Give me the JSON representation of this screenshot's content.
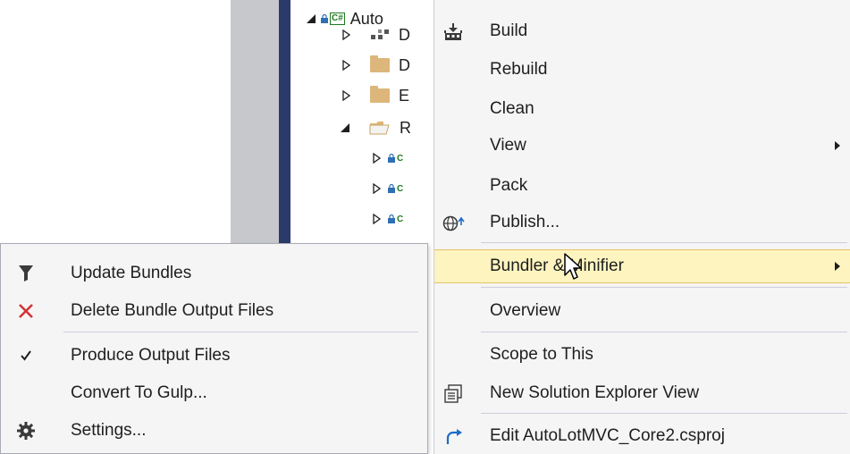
{
  "tree": {
    "project_label": "Auto",
    "project_badge": "C#",
    "rows": [
      {
        "label": "D"
      },
      {
        "label": "D"
      },
      {
        "label": "E"
      },
      {
        "label": "R"
      },
      {
        "badge": "C"
      },
      {
        "badge": "C"
      },
      {
        "badge": "C"
      }
    ]
  },
  "context_menu": {
    "items": [
      {
        "label": "Build",
        "icon": "build-icon"
      },
      {
        "label": "Rebuild"
      },
      {
        "label": "Clean"
      },
      {
        "label": "View",
        "has_submenu": true
      },
      {
        "label": "Pack"
      },
      {
        "label": "Publish...",
        "icon": "publish-globe-icon"
      },
      {
        "label": "Bundler & Minifier",
        "has_submenu": true,
        "highlighted": true
      },
      {
        "label": "Overview"
      },
      {
        "label": "Scope to This"
      },
      {
        "label": "New Solution Explorer View",
        "icon": "new-explorer-view-icon"
      },
      {
        "label": "Edit AutoLotMVC_Core2.csproj",
        "icon": "edit-arrow-icon"
      }
    ]
  },
  "submenu": {
    "items": [
      {
        "label": "Update Bundles",
        "icon": "funnel-icon"
      },
      {
        "label": "Delete Bundle Output Files",
        "icon": "delete-x-icon"
      },
      {
        "label": "Produce Output Files",
        "icon": "checkmark-icon",
        "checked": true
      },
      {
        "label": "Convert To Gulp..."
      },
      {
        "label": "Settings...",
        "icon": "gear-icon"
      }
    ]
  },
  "colors": {
    "menu_background": "#f5f5f5",
    "highlight_background": "#fdf4bf",
    "highlight_border": "#e5c365",
    "delete_red": "#d13438",
    "csharp_green": "#1e7a1e",
    "publish_blue": "#1e6cc8"
  }
}
